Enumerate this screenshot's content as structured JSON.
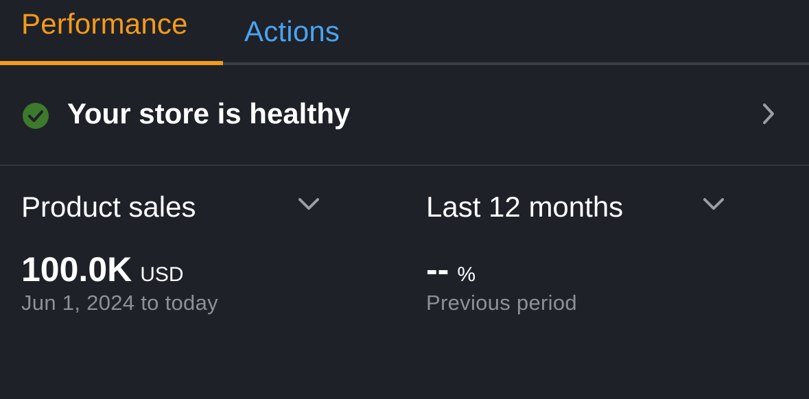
{
  "tabs": [
    {
      "label": "Performance",
      "active": true
    },
    {
      "label": "Actions",
      "active": false
    }
  ],
  "colors": {
    "background": "#1e2128",
    "tab_active": "#f49a1a",
    "tab_inactive": "#4aa3ee",
    "success_green": "#3d7a2b",
    "muted_text": "#8c9199"
  },
  "health": {
    "icon": "check-circle-icon",
    "text": "Your store is healthy",
    "chevron": "chevron-right-icon"
  },
  "metric": {
    "selector_label": "Product sales",
    "value": "100.0K",
    "unit": "USD",
    "subtitle": "Jun 1, 2024 to today"
  },
  "comparison": {
    "selector_label": "Last 12 months",
    "value": "--",
    "unit": "%",
    "subtitle": "Previous period"
  }
}
